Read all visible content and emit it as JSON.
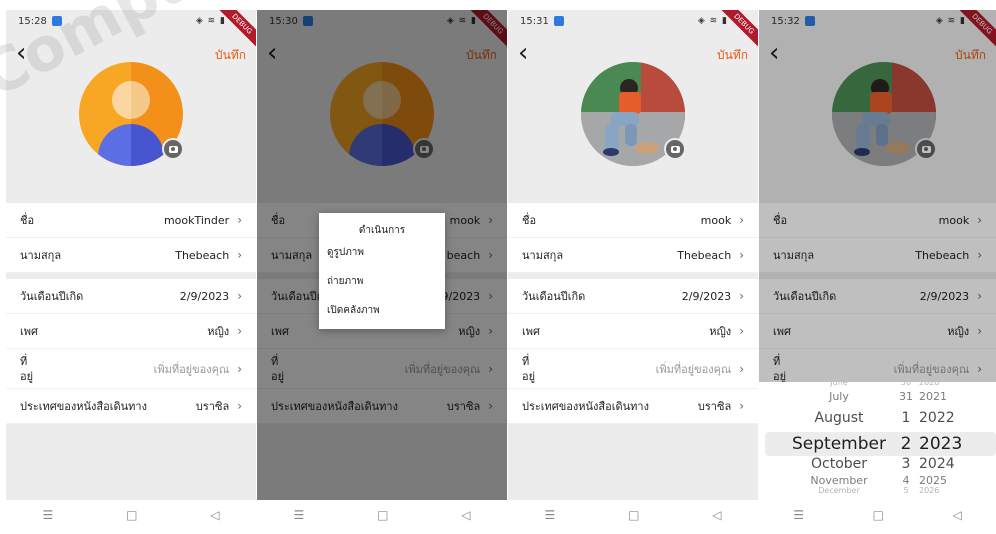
{
  "screens": [
    {
      "time": "15:28",
      "title_save": "บันทึก"
    },
    {
      "time": "15:30",
      "title_save": "บันทึก"
    },
    {
      "time": "15:31",
      "title_save": "บันทึก"
    },
    {
      "time": "15:32",
      "title_save": "บันทึก"
    }
  ],
  "debug_ribbon": "DEBUG",
  "profile_rows": {
    "name_label": "ชื่อ",
    "surname_label": "นามสกุล",
    "birthdate_label": "วันเดือนปีเกิด",
    "gender_label": "เพศ",
    "address_label_1": "ที่",
    "address_label_2": "อยู่",
    "passport_country_label": "ประเทศของหนังสือเดินทาง"
  },
  "values": {
    "name_screen1": "mookTinder",
    "name_screen2": "mook",
    "name_screen3": "mook",
    "name_screen4": "mook",
    "surname_screen1": "Thebeach",
    "surname_screen2": "beach",
    "surname_screen3": "Thebeach",
    "surname_screen4": "Thebeach",
    "birthdate": "2/9/2023",
    "birthdate_screen2": "2/9/2023",
    "gender": "หญิง",
    "address_placeholder": "เพิ่มที่อยู่ของคุณ",
    "passport_country": "บราซิล"
  },
  "action_menu": {
    "title": "ดำเนินการ",
    "items": [
      "ดูรูปภาพ",
      "ถ่ายภาพ",
      "เปิดคลังภาพ"
    ]
  },
  "date_picker": {
    "months": [
      "June",
      "July",
      "August",
      "September",
      "October",
      "November",
      "December"
    ],
    "days": [
      "30",
      "31",
      "1",
      "2",
      "3",
      "4",
      "5"
    ],
    "years": [
      "2020",
      "2021",
      "2022",
      "2023",
      "2024",
      "2025",
      "2026"
    ],
    "selected": {
      "month": "September",
      "day": "2",
      "year": "2023"
    }
  },
  "nav": {
    "menu": "☰",
    "home": "□",
    "back": "◁"
  },
  "watermark": "Computer Security & Int"
}
